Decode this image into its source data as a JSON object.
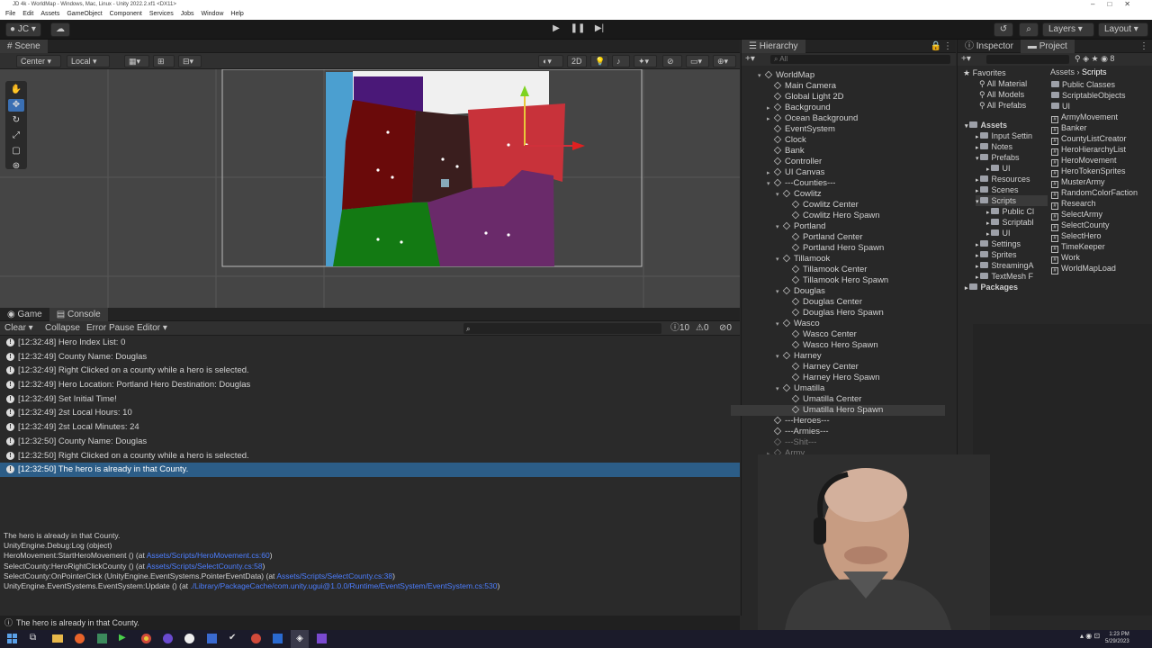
{
  "window": {
    "title": "JD 4k - WorldMap - Windows, Mac, Linux - Unity 2022.2.xf1 <DX11>"
  },
  "menu": [
    "File",
    "Edit",
    "Assets",
    "GameObject",
    "Component",
    "Services",
    "Jobs",
    "Window",
    "Help"
  ],
  "toolbar": {
    "account": "JC",
    "layers": "Layers",
    "layout": "Layout"
  },
  "scene": {
    "tab": "Scene",
    "pivot": "Center",
    "space": "Local",
    "mode_2d": "2D"
  },
  "console": {
    "tabs": [
      "Game",
      "Console"
    ],
    "buttons": {
      "clear": "Clear",
      "collapse": "Collapse",
      "error_pause": "Error Pause",
      "editor": "Editor"
    },
    "counts": {
      "info": "10",
      "warn": "0",
      "error": "0"
    },
    "logs": [
      "[12:32:48] Hero Index List: 0",
      "[12:32:49] County Name: Douglas",
      "[12:32:49] Right Clicked on a county while a hero is selected.",
      "[12:32:49] Hero Location: Portland Hero Destination: Douglas",
      "[12:32:49] Set Initial Time!",
      "[12:32:49] 2st Local Hours: 10",
      "[12:32:49] 2st Local Minutes: 24",
      "[12:32:50] County Name: Douglas",
      "[12:32:50] Right Clicked on a county while a hero is selected.",
      "[12:32:50] The hero is already in that County."
    ],
    "selected_index": 9,
    "detail": [
      {
        "text": "The hero is already in that County.",
        "link": ""
      },
      {
        "text": "UnityEngine.Debug:Log (object)",
        "link": ""
      },
      {
        "text": "HeroMovement:StartHeroMovement () (at ",
        "link": "Assets/Scripts/HeroMovement.cs:60",
        "end": ")"
      },
      {
        "text": "SelectCounty:HeroRightClickCounty () (at ",
        "link": "Assets/Scripts/SelectCounty.cs:58",
        "end": ")"
      },
      {
        "text": "SelectCounty:OnPointerClick (UnityEngine.EventSystems.PointerEventData) (at ",
        "link": "Assets/Scripts/SelectCounty.cs:38",
        "end": ")"
      },
      {
        "text": "UnityEngine.EventSystems.EventSystem:Update () (at ",
        "link": "./Library/PackageCache/com.unity.ugui@1.0.0/Runtime/EventSystem/EventSystem.cs:530",
        "end": ")"
      }
    ],
    "status": "The hero is already in that County."
  },
  "hierarchy": {
    "tab": "Hierarchy",
    "search_placeholder": "All",
    "items": [
      {
        "label": "WorldMap",
        "depth": 0,
        "arrow": "▾"
      },
      {
        "label": "Main Camera",
        "depth": 1,
        "arrow": ""
      },
      {
        "label": "Global Light 2D",
        "depth": 1,
        "arrow": ""
      },
      {
        "label": "Background",
        "depth": 1,
        "arrow": "▸"
      },
      {
        "label": "Ocean Background",
        "depth": 1,
        "arrow": "▸"
      },
      {
        "label": "EventSystem",
        "depth": 1,
        "arrow": ""
      },
      {
        "label": "Clock",
        "depth": 1,
        "arrow": ""
      },
      {
        "label": "Bank",
        "depth": 1,
        "arrow": ""
      },
      {
        "label": "Controller",
        "depth": 1,
        "arrow": ""
      },
      {
        "label": "UI Canvas",
        "depth": 1,
        "arrow": "▸"
      },
      {
        "label": "---Counties---",
        "depth": 1,
        "arrow": "▾"
      },
      {
        "label": "Cowlitz",
        "depth": 2,
        "arrow": "▾"
      },
      {
        "label": "Cowlitz Center",
        "depth": 3,
        "arrow": ""
      },
      {
        "label": "Cowlitz Hero Spawn",
        "depth": 3,
        "arrow": ""
      },
      {
        "label": "Portland",
        "depth": 2,
        "arrow": "▾"
      },
      {
        "label": "Portland Center",
        "depth": 3,
        "arrow": ""
      },
      {
        "label": "Portland Hero Spawn",
        "depth": 3,
        "arrow": ""
      },
      {
        "label": "Tillamook",
        "depth": 2,
        "arrow": "▾"
      },
      {
        "label": "Tillamook Center",
        "depth": 3,
        "arrow": ""
      },
      {
        "label": "Tillamook Hero Spawn",
        "depth": 3,
        "arrow": ""
      },
      {
        "label": "Douglas",
        "depth": 2,
        "arrow": "▾"
      },
      {
        "label": "Douglas Center",
        "depth": 3,
        "arrow": ""
      },
      {
        "label": "Douglas Hero Spawn",
        "depth": 3,
        "arrow": ""
      },
      {
        "label": "Wasco",
        "depth": 2,
        "arrow": "▾"
      },
      {
        "label": "Wasco Center",
        "depth": 3,
        "arrow": ""
      },
      {
        "label": "Wasco Hero Spawn",
        "depth": 3,
        "arrow": ""
      },
      {
        "label": "Harney",
        "depth": 2,
        "arrow": "▾"
      },
      {
        "label": "Harney Center",
        "depth": 3,
        "arrow": ""
      },
      {
        "label": "Harney Hero Spawn",
        "depth": 3,
        "arrow": ""
      },
      {
        "label": "Umatilla",
        "depth": 2,
        "arrow": "▾"
      },
      {
        "label": "Umatilla Center",
        "depth": 3,
        "arrow": ""
      },
      {
        "label": "Umatilla Hero Spawn",
        "depth": 3,
        "arrow": ""
      },
      {
        "label": "---Heroes---",
        "depth": 1,
        "arrow": ""
      },
      {
        "label": "---Armies---",
        "depth": 1,
        "arrow": ""
      },
      {
        "label": "---Shit---",
        "depth": 1,
        "arrow": ""
      },
      {
        "label": "Army",
        "depth": 1,
        "arrow": "▸"
      }
    ],
    "selected_index": 31
  },
  "project": {
    "tabs": [
      "Inspector",
      "Project"
    ],
    "breadcrumb": [
      "Assets",
      "Scripts"
    ],
    "favorites": {
      "label": "Favorites",
      "items": [
        "All Material",
        "All Models",
        "All Prefabs"
      ]
    },
    "tree": [
      {
        "label": "Assets",
        "depth": 0
      },
      {
        "label": "Input Settin",
        "depth": 1
      },
      {
        "label": "Notes",
        "depth": 1
      },
      {
        "label": "Prefabs",
        "depth": 1
      },
      {
        "label": "UI",
        "depth": 2
      },
      {
        "label": "Resources",
        "depth": 1
      },
      {
        "label": "Scenes",
        "depth": 1
      },
      {
        "label": "Scripts",
        "depth": 1
      },
      {
        "label": "Public Cl",
        "depth": 2
      },
      {
        "label": "Scriptabl",
        "depth": 2
      },
      {
        "label": "UI",
        "depth": 2
      },
      {
        "label": "Settings",
        "depth": 1
      },
      {
        "label": "Sprites",
        "depth": 1
      },
      {
        "label": "StreamingA",
        "depth": 1
      },
      {
        "label": "TextMesh F",
        "depth": 1
      },
      {
        "label": "Packages",
        "depth": 0
      }
    ],
    "files": [
      {
        "label": "Public Classes",
        "kind": "folder"
      },
      {
        "label": "ScriptableObjects",
        "kind": "folder"
      },
      {
        "label": "UI",
        "kind": "folder"
      },
      {
        "label": "ArmyMovement",
        "kind": "script"
      },
      {
        "label": "Banker",
        "kind": "script"
      },
      {
        "label": "CountyListCreator",
        "kind": "script"
      },
      {
        "label": "HeroHierarchyList",
        "kind": "script"
      },
      {
        "label": "HeroMovement",
        "kind": "script"
      },
      {
        "label": "HeroTokenSprites",
        "kind": "script"
      },
      {
        "label": "MusterArmy",
        "kind": "script"
      },
      {
        "label": "RandomColorFaction",
        "kind": "script"
      },
      {
        "label": "Research",
        "kind": "script"
      },
      {
        "label": "SelectArmy",
        "kind": "script"
      },
      {
        "label": "SelectCounty",
        "kind": "script"
      },
      {
        "label": "SelectHero",
        "kind": "script"
      },
      {
        "label": "TimeKeeper",
        "kind": "script"
      },
      {
        "label": "Work",
        "kind": "script"
      },
      {
        "label": "WorldMapLoad",
        "kind": "script"
      }
    ]
  },
  "taskbar": {
    "time": "1:23 PM",
    "date": "5/29/2023"
  },
  "colors": {
    "accent": "#2c5d87",
    "link": "#4c7eff",
    "ocean": "#4b9fd0"
  }
}
